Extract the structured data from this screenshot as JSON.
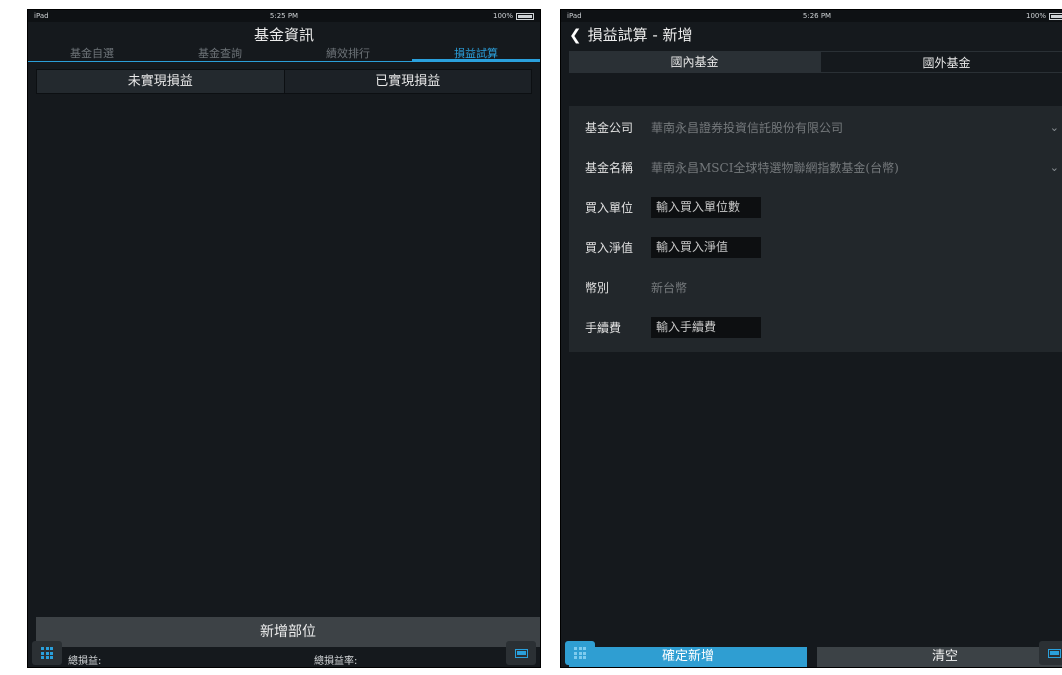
{
  "left": {
    "status": {
      "device": "iPad",
      "time": "5:25 PM",
      "battery": "100%"
    },
    "title": "基金資訊",
    "tabs": [
      "基金自選",
      "基金查詢",
      "績效排行",
      "損益試算"
    ],
    "segments": [
      "未實現損益",
      "已實現損益"
    ],
    "add_button": "新增部位",
    "footer": {
      "total_pl": "總損益:",
      "total_rate": "總損益率:"
    }
  },
  "right": {
    "status": {
      "device": "iPad",
      "time": "5:26 PM",
      "battery": "100%"
    },
    "back_icon": "chevron-left-icon",
    "title": "損益試算 - 新增",
    "segments": [
      "國內基金",
      "國外基金"
    ],
    "form": {
      "company": {
        "label": "基金公司",
        "value": "華南永昌證券投資信託股份有限公司"
      },
      "fund": {
        "label": "基金名稱",
        "value": "華南永昌MSCI全球特選物聯網指數基金(台幣)"
      },
      "units": {
        "label": "買入單位",
        "placeholder": "輸入買入單位數"
      },
      "nav": {
        "label": "買入淨值",
        "placeholder": "輸入買入淨值"
      },
      "currency": {
        "label": "幣別",
        "value": "新台幣"
      },
      "fee": {
        "label": "手續費",
        "placeholder": "輸入手續費"
      }
    },
    "confirm_button": "確定新增",
    "clear_button": "清空"
  },
  "colors": {
    "accent": "#2aa0dc",
    "background": "#15191d",
    "form_bg": "#22272b"
  }
}
